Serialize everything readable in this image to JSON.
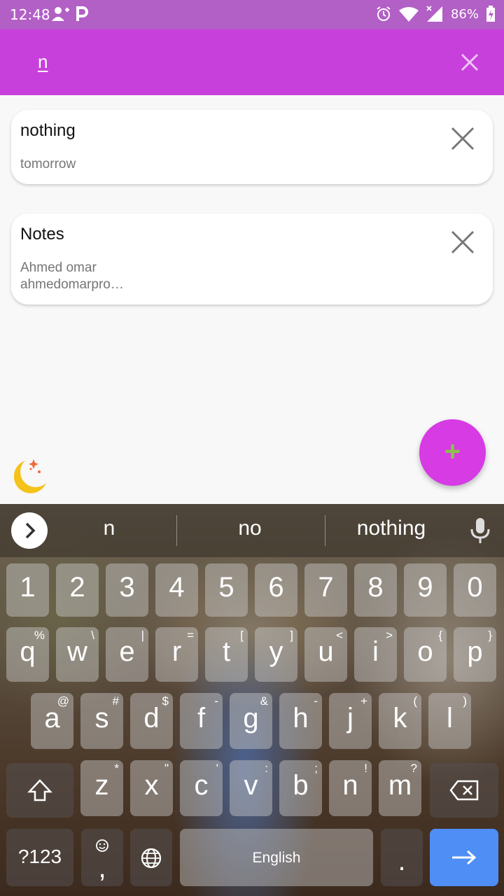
{
  "status_bar": {
    "time": "12:48",
    "battery": "86%"
  },
  "search": {
    "query": "n"
  },
  "notes": [
    {
      "title": "nothing",
      "subtitle": "tomorrow"
    },
    {
      "title": "Notes",
      "subtitle": "Ahmed omar ahmedomarpro…"
    }
  ],
  "keyboard": {
    "suggestions": [
      "n",
      "no",
      "nothing"
    ],
    "row_numbers": [
      "1",
      "2",
      "3",
      "4",
      "5",
      "6",
      "7",
      "8",
      "9",
      "0"
    ],
    "row_q": {
      "keys": [
        "q",
        "w",
        "e",
        "r",
        "t",
        "y",
        "u",
        "i",
        "o",
        "p"
      ],
      "hints": [
        "%",
        "\\",
        "|",
        "=",
        "[",
        "]",
        "<",
        ">",
        "{",
        "}"
      ]
    },
    "row_a": {
      "keys": [
        "a",
        "s",
        "d",
        "f",
        "g",
        "h",
        "j",
        "k",
        "l"
      ],
      "hints": [
        "@",
        "#",
        "$",
        "-",
        "&",
        "-",
        "+",
        "(",
        ")"
      ]
    },
    "row_z": {
      "keys": [
        "z",
        "x",
        "c",
        "v",
        "b",
        "n",
        "m"
      ],
      "hints": [
        "*",
        "\"",
        "'",
        ":",
        ";",
        "!",
        "?"
      ]
    },
    "symbols_label": "?123",
    "comma": ",",
    "space_label": "English",
    "period": "."
  },
  "colors": {
    "status_bar": "#b25fc6",
    "search_bar": "#c840dc",
    "fab": "#d63be4",
    "fab_plus": "#8bc34a",
    "enter_key": "#4e8ef5"
  },
  "icons": {
    "close": "close-icon",
    "add": "plus-icon",
    "theme": "moon-icon",
    "mic": "mic-icon",
    "shift": "shift-icon",
    "backspace": "backspace-icon",
    "globe": "globe-icon",
    "emoji": "emoji-icon",
    "enter": "arrow-right-icon"
  }
}
